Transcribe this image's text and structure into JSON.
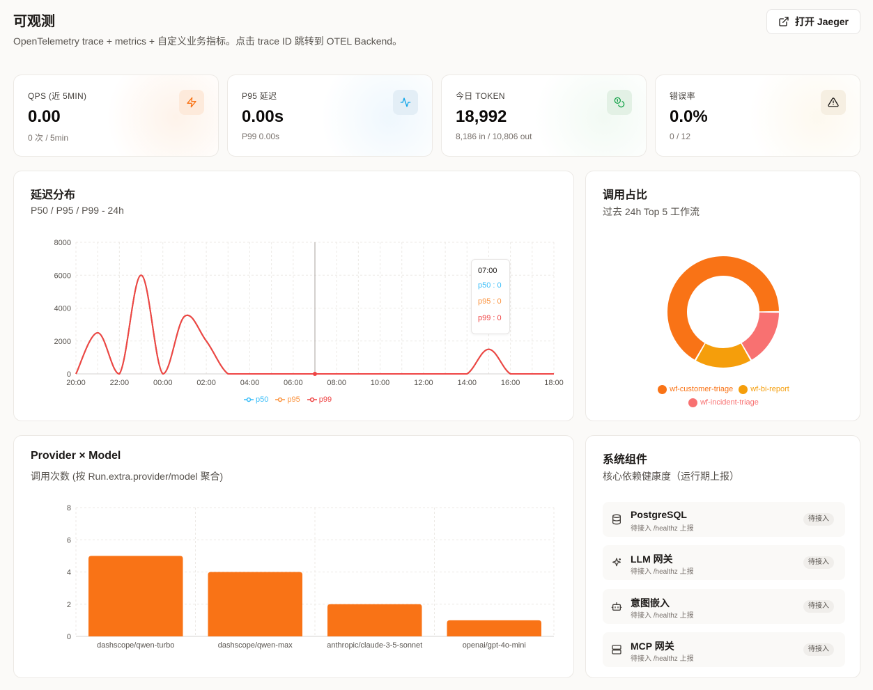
{
  "header": {
    "title": "可观测",
    "subtitle": "OpenTelemetry trace + metrics + 自定义业务指标。点击 trace ID 跳转到 OTEL Backend。",
    "jaeger_label": "打开 Jaeger"
  },
  "stats": [
    {
      "label": "QPS (近 5MIN)",
      "value": "0.00",
      "sub": "0 次 / 5min",
      "icon": "lightning-icon",
      "accent": "#f97316"
    },
    {
      "label": "P95 延迟",
      "value": "0.00s",
      "sub": "P99 0.00s",
      "icon": "activity-icon",
      "accent": "#0ea5e9"
    },
    {
      "label": "今日 TOKEN",
      "value": "18,992",
      "sub": "8,186 in / 10,806 out",
      "icon": "coins-icon",
      "accent": "#16a34a"
    },
    {
      "label": "错误率",
      "value": "0.0%",
      "sub": "0 / 12",
      "icon": "warning-icon",
      "accent": "#1c1917"
    }
  ],
  "latency": {
    "title": "延迟分布",
    "subtitle": "P50 / P95 / P99 - 24h",
    "tooltip": {
      "time": "07:00",
      "p50": "p50 : 0",
      "p95": "p95 : 0",
      "p99": "p99 : 0"
    }
  },
  "calls": {
    "title": "调用占比",
    "subtitle": "过去 24h Top 5 工作流"
  },
  "provider": {
    "title": "Provider × Model",
    "subtitle": "调用次数 (按 Run.extra.provider/model 聚合)"
  },
  "components": {
    "title": "系统组件",
    "subtitle": "核心依赖健康度（运行期上报）",
    "items": [
      {
        "name": "PostgreSQL",
        "desc": "待接入 /healthz 上报",
        "badge": "待接入",
        "icon": "database-icon"
      },
      {
        "name": "LLM 网关",
        "desc": "待接入 /healthz 上报",
        "badge": "待接入",
        "icon": "sparkles-icon"
      },
      {
        "name": "意图嵌入",
        "desc": "待接入 /healthz 上报",
        "badge": "待接入",
        "icon": "bot-icon"
      },
      {
        "name": "MCP 网关",
        "desc": "待接入 /healthz 上报",
        "badge": "待接入",
        "icon": "server-icon"
      }
    ]
  },
  "chart_data": [
    {
      "type": "line",
      "x": [
        "20:00",
        "21:00",
        "22:00",
        "23:00",
        "00:00",
        "01:00",
        "02:00",
        "03:00",
        "04:00",
        "05:00",
        "06:00",
        "07:00",
        "08:00",
        "09:00",
        "10:00",
        "11:00",
        "12:00",
        "13:00",
        "14:00",
        "15:00",
        "16:00",
        "17:00",
        "18:00"
      ],
      "x_ticks": [
        "20:00",
        "22:00",
        "00:00",
        "02:00",
        "04:00",
        "06:00",
        "08:00",
        "10:00",
        "12:00",
        "14:00",
        "16:00",
        "18:00"
      ],
      "ylim": [
        0,
        8000
      ],
      "y_ticks": [
        0,
        2000,
        4000,
        6000,
        8000
      ],
      "series": [
        {
          "name": "p50",
          "color": "#38bdf8",
          "values": [
            0,
            2500,
            0,
            6000,
            0,
            3500,
            2000,
            0,
            0,
            0,
            0,
            0,
            0,
            0,
            0,
            0,
            0,
            0,
            0,
            1500,
            0,
            0,
            0
          ]
        },
        {
          "name": "p95",
          "color": "#fb923c",
          "values": [
            0,
            2500,
            0,
            6000,
            0,
            3500,
            2000,
            0,
            0,
            0,
            0,
            0,
            0,
            0,
            0,
            0,
            0,
            0,
            0,
            1500,
            0,
            0,
            0
          ]
        },
        {
          "name": "p99",
          "color": "#ef4444",
          "values": [
            0,
            2500,
            0,
            6000,
            0,
            3500,
            2000,
            0,
            0,
            0,
            0,
            0,
            0,
            0,
            0,
            0,
            0,
            0,
            0,
            1500,
            0,
            0,
            0
          ]
        }
      ],
      "legend": "bottom",
      "grid": true
    },
    {
      "type": "pie",
      "labels": [
        "wf-customer-triage",
        "wf-bi-report",
        "wf-incident-triage"
      ],
      "values": [
        8,
        2,
        2
      ],
      "colors": [
        "#f97316",
        "#f59e0b",
        "#f87171"
      ],
      "legend": "bottom"
    },
    {
      "type": "bar",
      "categories": [
        "dashscope/qwen-turbo",
        "dashscope/qwen-max",
        "anthropic/claude-3-5-sonnet",
        "openai/gpt-4o-mini"
      ],
      "values": [
        5,
        4,
        2,
        1
      ],
      "ylim": [
        0,
        8
      ],
      "y_ticks": [
        0,
        2,
        4,
        6,
        8
      ],
      "color": "#f97316",
      "grid": true
    }
  ]
}
